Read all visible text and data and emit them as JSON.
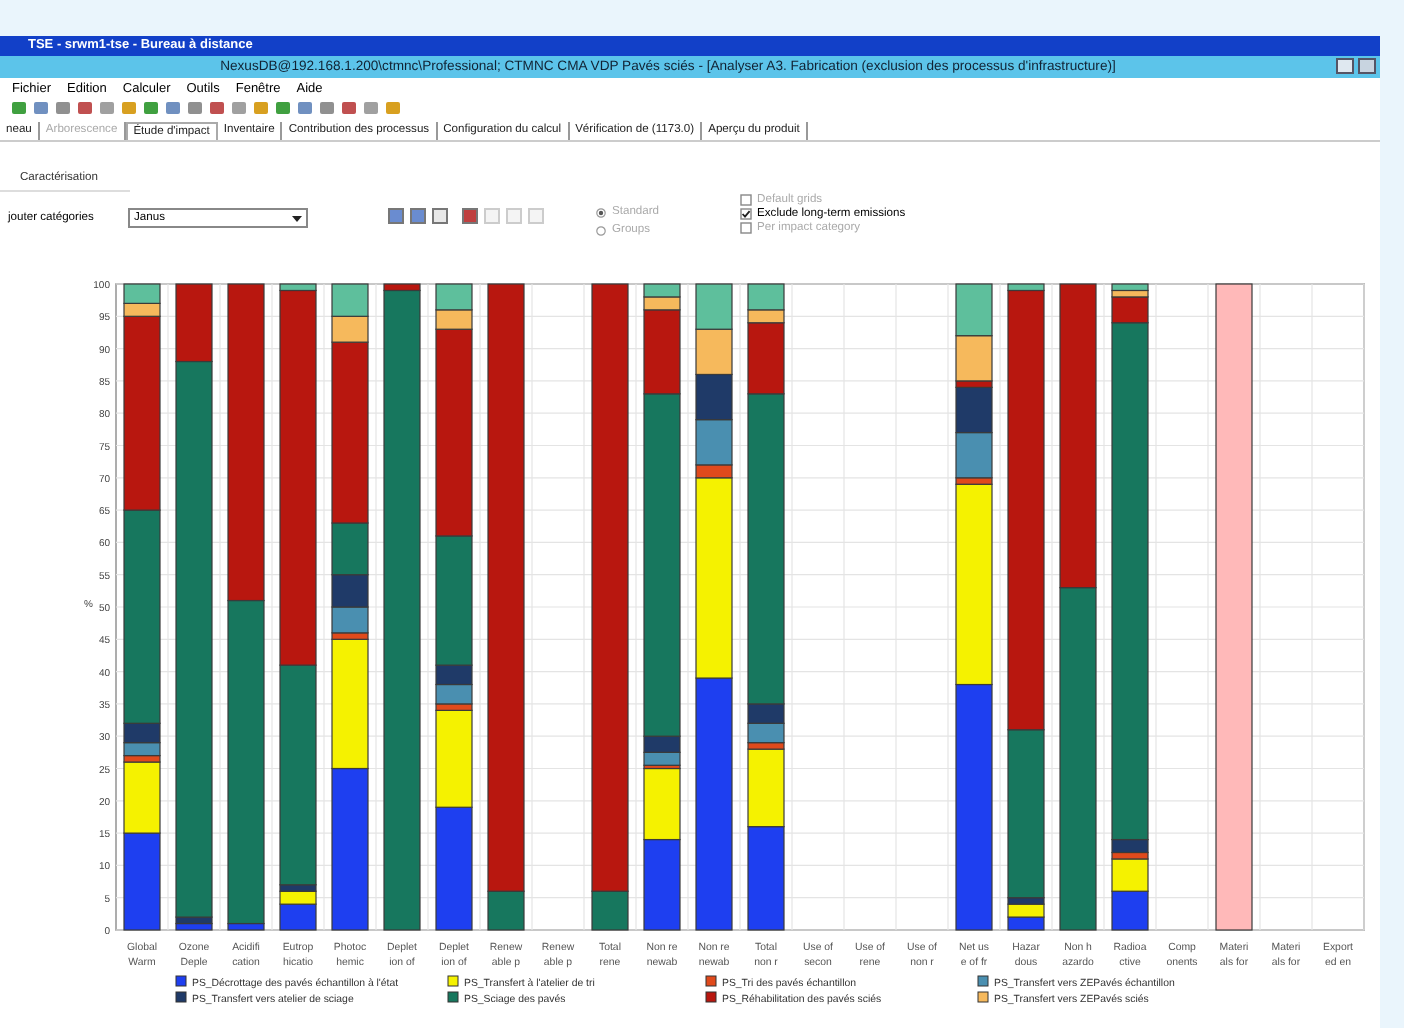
{
  "remote_title": "TSE - srwm1-tse - Bureau à distance",
  "window": {
    "title": "NexusDB@192.168.1.200\\ctmnc\\Professional; CTMNC CMA VDP Pavés sciés - [Analyser A3. Fabrication (exclusion des processus d'infrastructure)]"
  },
  "menu": [
    "Fichier",
    "Edition",
    "Calculer",
    "Outils",
    "Fenêtre",
    "Aide"
  ],
  "tabs": [
    {
      "label": "neau",
      "selected": false,
      "disabled": false
    },
    {
      "label": "Arborescence",
      "selected": false,
      "disabled": true
    },
    {
      "label": "Étude d'impact",
      "selected": true,
      "disabled": false
    },
    {
      "label": "Inventaire",
      "selected": false,
      "disabled": false
    },
    {
      "label": "Contribution des processus",
      "selected": false,
      "disabled": false
    },
    {
      "label": "Configuration du calcul",
      "selected": false,
      "disabled": false
    },
    {
      "label": "Vérification de (1173.0)",
      "selected": false,
      "disabled": false
    },
    {
      "label": "Aperçu du produit",
      "selected": false,
      "disabled": false
    }
  ],
  "subtab": "Caractérisation",
  "category_field": {
    "label": "jouter catégories",
    "value": "Janus"
  },
  "radios": [
    {
      "label": "Standard",
      "selected": true,
      "disabled": true
    },
    {
      "label": "Groups",
      "selected": false,
      "disabled": true
    }
  ],
  "checkboxes": [
    {
      "label": "Default grids",
      "checked": false,
      "disabled": true
    },
    {
      "label": "Exclude long-term emissions",
      "checked": true,
      "disabled": false
    },
    {
      "label": "Per impact category",
      "checked": false,
      "disabled": true
    }
  ],
  "chart_data": {
    "type": "bar",
    "stacked": true,
    "grid": true,
    "legend": true,
    "ylabel": "%",
    "ylim": [
      0,
      100
    ],
    "yticks": [
      0,
      5,
      10,
      15,
      20,
      25,
      30,
      35,
      40,
      45,
      50,
      55,
      60,
      65,
      70,
      75,
      80,
      85,
      90,
      95,
      100
    ],
    "categories": [
      "Global\nWarm",
      "Ozone\nDeple",
      "Acidifi\ncation",
      "Eutrop\nhicatio",
      "Photoc\nhemic",
      "Deplet\nion of",
      "Deplet\nion of",
      "Renew\nable p",
      "Renew\nable p",
      "Total\nrene",
      "Non re\nnewab",
      "Non re\nnewab",
      "Total\nnon r",
      "Use of\nsecon",
      "Use of\nrene",
      "Use of\nnon r",
      "Net us\ne of fr",
      "Hazar\ndous",
      "Non h\nazardo",
      "Radioa\nctive",
      "Comp\nonents",
      "Materi\nals for",
      "Materi\nals for",
      "Export\ned en"
    ],
    "series": [
      {
        "name": "PS_Décrottage des pavés échantillon à l'état",
        "color": "#1e3ff0",
        "values": [
          15,
          1,
          1,
          4,
          25,
          0,
          19,
          0,
          null,
          0,
          14,
          39,
          16,
          null,
          null,
          null,
          38,
          2,
          0,
          6,
          null,
          0,
          null,
          null
        ]
      },
      {
        "name": "PS_Transfert à l'atelier de tri",
        "color": "#f5f200",
        "values": [
          11,
          0,
          0,
          2,
          20,
          0,
          15,
          0,
          null,
          0,
          11,
          31,
          12,
          null,
          null,
          null,
          31,
          2,
          0,
          5,
          null,
          0,
          null,
          null
        ]
      },
      {
        "name": "PS_Tri des pavés échantillon",
        "color": "#e04a1c",
        "values": [
          1,
          0,
          0,
          0,
          1,
          0,
          1,
          0,
          null,
          0,
          0.5,
          2,
          1,
          null,
          null,
          null,
          1,
          0,
          0,
          1,
          null,
          0,
          null,
          null
        ]
      },
      {
        "name": "PS_Transfert vers ZEPavés échantillon",
        "color": "#4a8fb0",
        "values": [
          2,
          0,
          0,
          0,
          4,
          0,
          3,
          0,
          null,
          0,
          2,
          7,
          3,
          null,
          null,
          null,
          7,
          0,
          0,
          0,
          null,
          0,
          null,
          null
        ]
      },
      {
        "name": "PS_Transfert vers atelier de sciage",
        "color": "#1f3a68",
        "values": [
          3,
          1,
          0,
          1,
          5,
          0,
          3,
          0,
          null,
          0,
          2.5,
          7,
          3,
          null,
          null,
          null,
          7,
          1,
          0,
          2,
          null,
          0,
          null,
          null
        ]
      },
      {
        "name": "PS_Sciage des pavés",
        "color": "#17775e",
        "values": [
          33,
          86,
          50,
          34,
          8,
          99,
          20,
          6,
          null,
          6,
          53,
          0,
          48,
          null,
          null,
          null,
          0,
          26,
          53,
          80,
          null,
          0,
          null,
          null
        ]
      },
      {
        "name": "PS_Réhabilitation des pavés sciés",
        "color": "#b8170f",
        "values": [
          30,
          12,
          49,
          58,
          28,
          1,
          32,
          94,
          null,
          94,
          13,
          0,
          11,
          null,
          null,
          null,
          1,
          68,
          47,
          4,
          null,
          0,
          null,
          null
        ]
      },
      {
        "name": "PS_Transfert vers ZEPavés sciés",
        "color": "#f6b95c",
        "values": [
          2,
          0,
          0,
          0,
          4,
          0,
          3,
          0,
          null,
          0,
          2,
          7,
          2,
          null,
          null,
          null,
          7,
          0,
          0,
          1,
          null,
          0,
          null,
          null
        ]
      },
      {
        "color": "#5ebf9c",
        "values": [
          3,
          0,
          0,
          1,
          5,
          0,
          4,
          0,
          null,
          0,
          2,
          7,
          4,
          null,
          null,
          null,
          8,
          1,
          0,
          1,
          null,
          0,
          null,
          null
        ]
      },
      {
        "color": "#ffb9b9",
        "values": [
          0,
          0,
          0,
          0,
          0,
          0,
          0,
          0,
          null,
          0,
          0,
          0,
          0,
          null,
          null,
          null,
          0,
          0,
          0,
          0,
          null,
          100,
          null,
          null
        ]
      }
    ]
  }
}
